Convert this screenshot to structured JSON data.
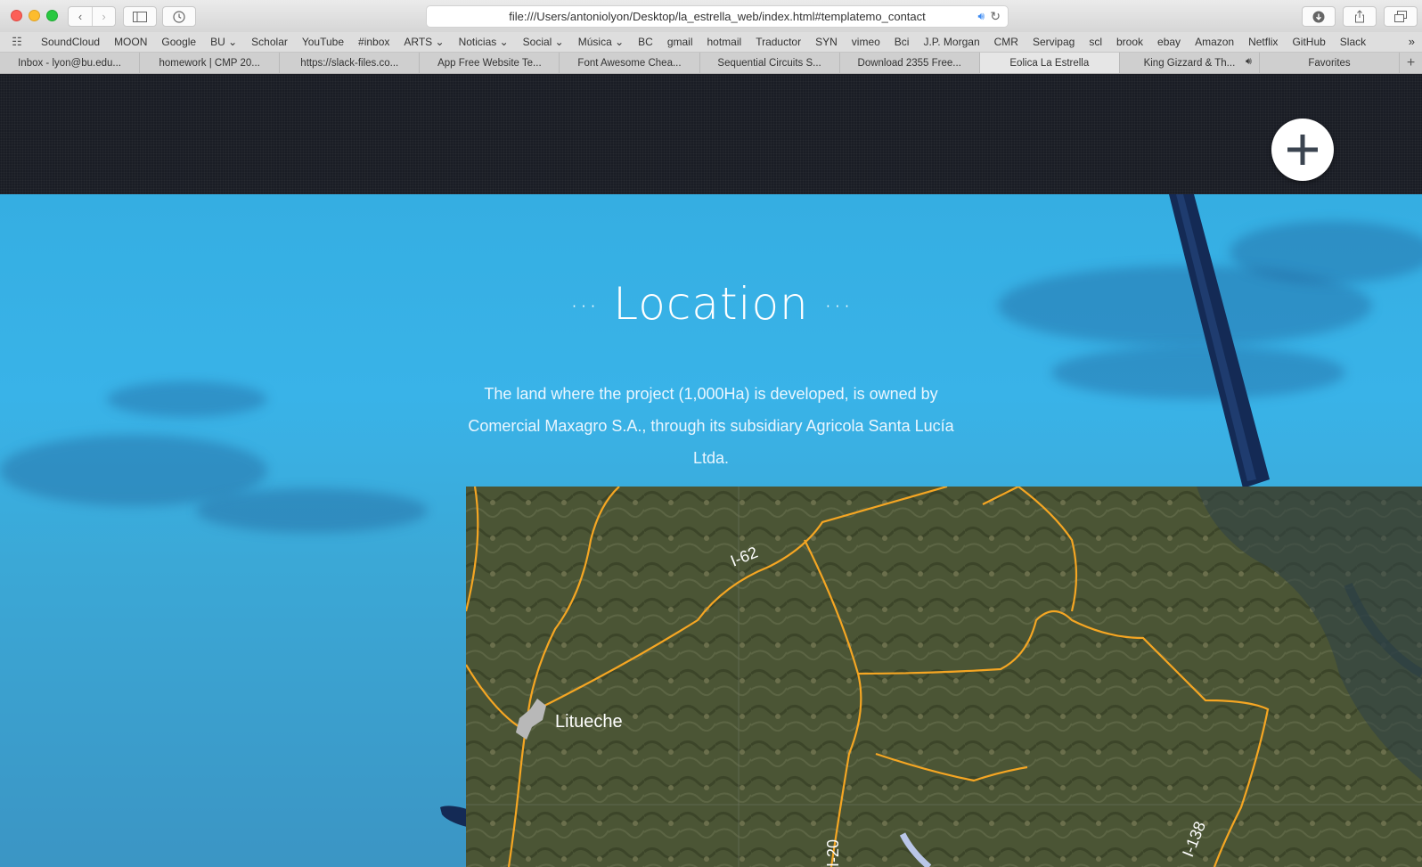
{
  "browser": {
    "url": "file:///Users/antoniolyon/Desktop/la_estrella_web/index.html#templatemo_contact",
    "bookmarks": [
      "SoundCloud",
      "MOON",
      "Google",
      "BU ⌄",
      "Scholar",
      "YouTube",
      "#inbox",
      "ARTS ⌄",
      "Noticias ⌄",
      "Social ⌄",
      "Música ⌄",
      "BC",
      "gmail",
      "hotmail",
      "Traductor",
      "SYN",
      "vimeo",
      "Bci",
      "J.P. Morgan",
      "CMR",
      "Servipag",
      "scl",
      "brook",
      "ebay",
      "Amazon",
      "Netflix",
      "GitHub",
      "Slack"
    ],
    "tabs": [
      {
        "label": "Inbox - lyon@bu.edu..."
      },
      {
        "label": "homework | CMP 20..."
      },
      {
        "label": "https://slack-files.co..."
      },
      {
        "label": "App Free Website Te..."
      },
      {
        "label": "Font Awesome Chea..."
      },
      {
        "label": "Sequential Circuits S..."
      },
      {
        "label": "Download 2355 Free..."
      },
      {
        "label": "Eolica La Estrella"
      },
      {
        "label": "King Gizzard & Th..."
      },
      {
        "label": "Favorites"
      }
    ],
    "active_tab_index": 7
  },
  "page": {
    "section_title": "Location",
    "title_dots": "···",
    "description": "The land where the project (1,000Ha) is developed, is owned by Comercial Maxagro S.A., through its subsidiary Agricola Santa Lucía Ltda.",
    "map_labels": {
      "town": "Litueche",
      "road_1": "I-62",
      "road_2": "I-138",
      "road_3": "I-20"
    }
  },
  "colors": {
    "sky": "#38b0e4",
    "road": "#f5a623",
    "band": "#1a1d25"
  }
}
